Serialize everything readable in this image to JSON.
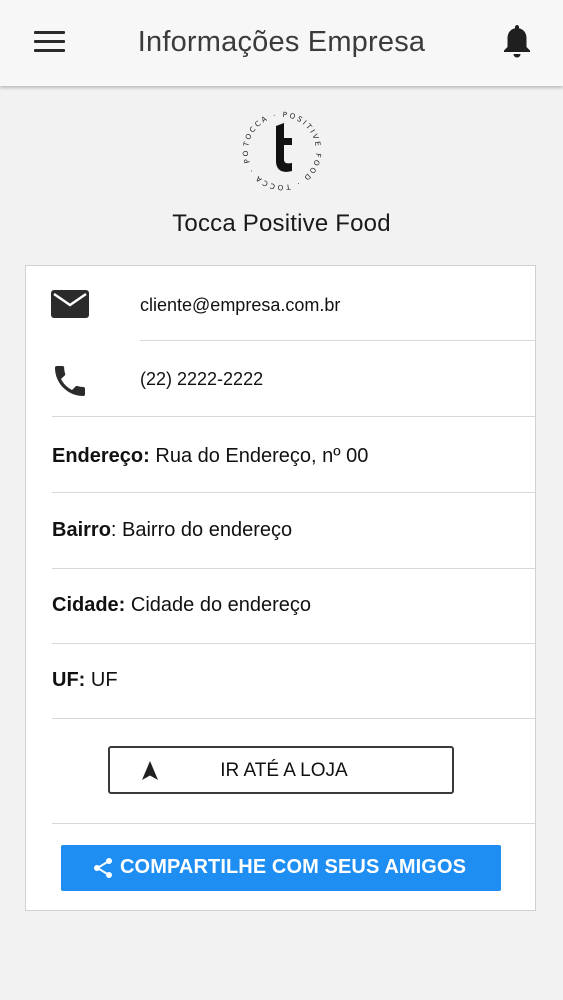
{
  "header": {
    "title": "Informações Empresa"
  },
  "company": {
    "logo_text": "TOCCA POSITIVE FOOD",
    "name": "Tocca Positive Food"
  },
  "contact": {
    "email": "cliente@empresa.com.br",
    "phone": "(22) 2222-2222"
  },
  "address": {
    "street_label": "Endereço:",
    "street_value": "Rua do Endereço, nº 00",
    "district_label": "Bairro",
    "district_value": ": Bairro do endereço",
    "city_label": "Cidade:",
    "city_value": "Cidade do endereço",
    "state_label": "UF:",
    "state_value": "UF"
  },
  "actions": {
    "go_to_store_label": "IR ATÉ A LOJA",
    "share_label": "COMPARTILHE COM SEUS AMIGOS"
  },
  "icons": {
    "menu": "hamburger-menu-icon",
    "notifications": "bell-icon",
    "email": "envelope-icon",
    "phone": "phone-icon",
    "navigate": "navigation-arrow-icon",
    "share": "share-icon"
  },
  "colors": {
    "share_button": "#1e8ef2",
    "background": "#f2f2f2",
    "appbar": "#f7f7f7"
  }
}
